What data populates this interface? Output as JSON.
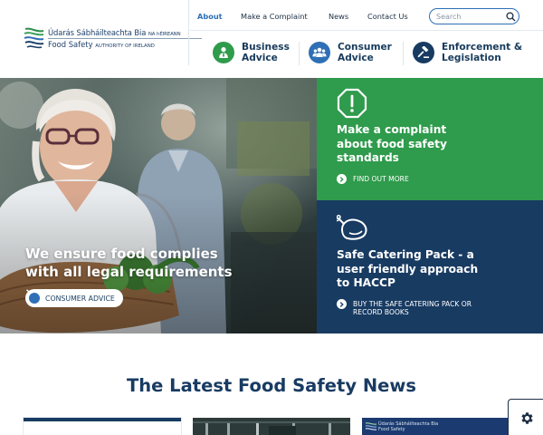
{
  "header": {
    "logo": {
      "irish_name": "Údarás Sábháilteachta Bia",
      "irish_suffix": "NA hÉIREANN",
      "english_name": "Food Safety",
      "english_suffix": "AUTHORITY OF IRELAND"
    },
    "topnav": [
      {
        "label": "About",
        "active": true
      },
      {
        "label": "Make a Complaint",
        "active": false
      },
      {
        "label": "News",
        "active": false
      },
      {
        "label": "Contact Us",
        "active": false
      }
    ],
    "search": {
      "placeholder": "Search",
      "value": ""
    },
    "mainnav": [
      {
        "line1": "Business",
        "line2": "Advice",
        "icon": "business-person-icon",
        "color": "#2f9b4c"
      },
      {
        "line1": "Consumer",
        "line2": "Advice",
        "icon": "consumer-group-icon",
        "color": "#2f6fb6"
      },
      {
        "line1": "Enforcement &",
        "line2": "Legislation",
        "icon": "gavel-icon",
        "color": "#183b62"
      }
    ]
  },
  "hero": {
    "title_line1": "We ensure food complies",
    "title_line2": "with all legal requirements",
    "button": "CONSUMER ADVICE"
  },
  "panels": [
    {
      "icon": "alert-octagon-icon",
      "title_lines": [
        "Make a complaint",
        "about food safety",
        "standards"
      ],
      "link_lines": [
        "FIND OUT MORE"
      ],
      "color": "#2f9b4c"
    },
    {
      "icon": "roast-chicken-icon",
      "title_lines": [
        "Safe Catering Pack - a",
        "user friendly approach",
        "to HACCP"
      ],
      "link_lines": [
        "BUY THE SAFE CATERING PACK OR",
        "RECORD BOOKS"
      ],
      "color": "#183b62"
    }
  ],
  "news": {
    "heading": "The Latest Food Safety News",
    "card3_logo_line1": "Údarás Sábháilteachta Bia",
    "card3_logo_line2": "Food Safety"
  },
  "cookie": {
    "icon": "gear-icon"
  }
}
